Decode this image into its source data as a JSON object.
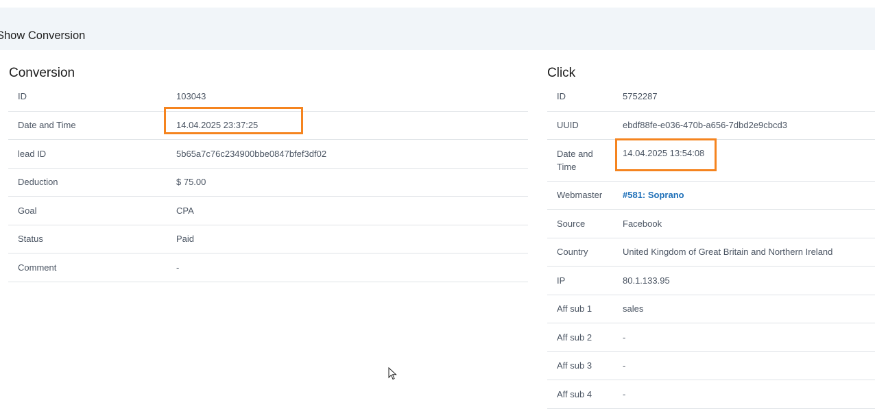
{
  "page": {
    "title": "Show Conversion"
  },
  "conversion": {
    "title": "Conversion",
    "rows": [
      {
        "label": "ID",
        "value": "103043"
      },
      {
        "label": "Date and Time",
        "value": "14.04.2025 23:37:25"
      },
      {
        "label": "lead ID",
        "value": "5b65a7c76c234900bbe0847bfef3df02"
      },
      {
        "label": "Deduction",
        "value": "$ 75.00"
      },
      {
        "label": "Goal",
        "value": "CPA"
      },
      {
        "label": "Status",
        "value": "Paid"
      },
      {
        "label": "Comment",
        "value": "-"
      }
    ]
  },
  "click": {
    "title": "Click",
    "rows": [
      {
        "label": "ID",
        "value": "5752287"
      },
      {
        "label": "UUID",
        "value": "ebdf88fe-e036-470b-a656-7dbd2e9cbcd3"
      },
      {
        "label": "Date and Time",
        "value": "14.04.2025 13:54:08"
      },
      {
        "label": "Webmaster",
        "value": "#581: Soprano"
      },
      {
        "label": "Source",
        "value": "Facebook"
      },
      {
        "label": "Country",
        "value": "United Kingdom of Great Britain and Northern Ireland"
      },
      {
        "label": "IP",
        "value": "80.1.133.95"
      },
      {
        "label": "Aff sub 1",
        "value": "sales"
      },
      {
        "label": "Aff sub 2",
        "value": "-"
      },
      {
        "label": "Aff sub 3",
        "value": "-"
      },
      {
        "label": "Aff sub 4",
        "value": "-"
      }
    ]
  },
  "colors": {
    "highlight": "#f5841f",
    "link": "#1d6fb8",
    "header_band": "#f1f5f9"
  }
}
